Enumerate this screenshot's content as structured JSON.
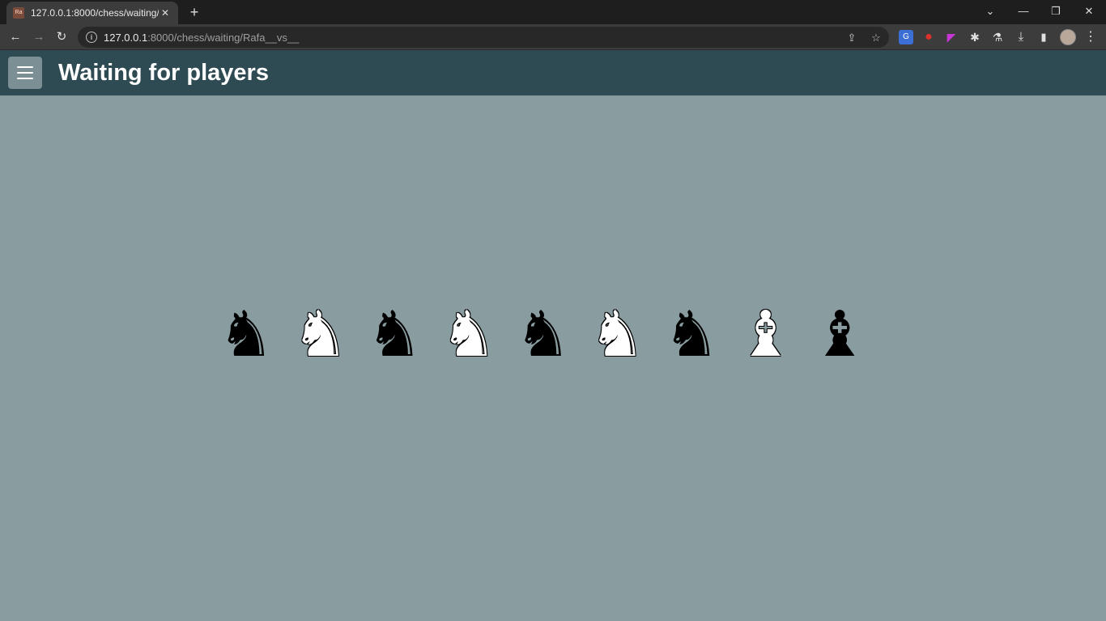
{
  "browser": {
    "tab": {
      "title": "127.0.0.1:8000/chess/waiting/Rafa__vs__",
      "favicon_text": "Ra",
      "close_glyph": "✕"
    },
    "new_tab_glyph": "+",
    "window_controls": {
      "tab_search": "⌄",
      "minimize": "—",
      "restore": "❐",
      "close": "✕"
    },
    "nav": {
      "back": "←",
      "forward": "→",
      "reload": "↻"
    },
    "address": {
      "host": "127.0.0.1",
      "path": ":8000/chess/waiting/Rafa__vs__",
      "info_glyph": "i"
    },
    "omnibox_icons": {
      "share": "⇪",
      "bookmark": "☆"
    },
    "extensions": {
      "translate": "G",
      "shield": "●",
      "flag": "◤",
      "puzzle": "✱",
      "labs": "⚗",
      "download": "⤓",
      "sidepanel": "▮",
      "menu": "⋮"
    }
  },
  "header": {
    "title": "Waiting for players",
    "background": "#2e4a52"
  },
  "content": {
    "background": "#899ca0",
    "pieces": [
      {
        "glyph": "♞",
        "color": "black"
      },
      {
        "glyph": "♞",
        "color": "white"
      },
      {
        "glyph": "♞",
        "color": "black"
      },
      {
        "glyph": "♞",
        "color": "white"
      },
      {
        "glyph": "♞",
        "color": "black"
      },
      {
        "glyph": "♞",
        "color": "white"
      },
      {
        "glyph": "♞",
        "color": "black"
      },
      {
        "glyph": "♝",
        "color": "white"
      },
      {
        "glyph": "♝",
        "color": "black"
      }
    ]
  }
}
